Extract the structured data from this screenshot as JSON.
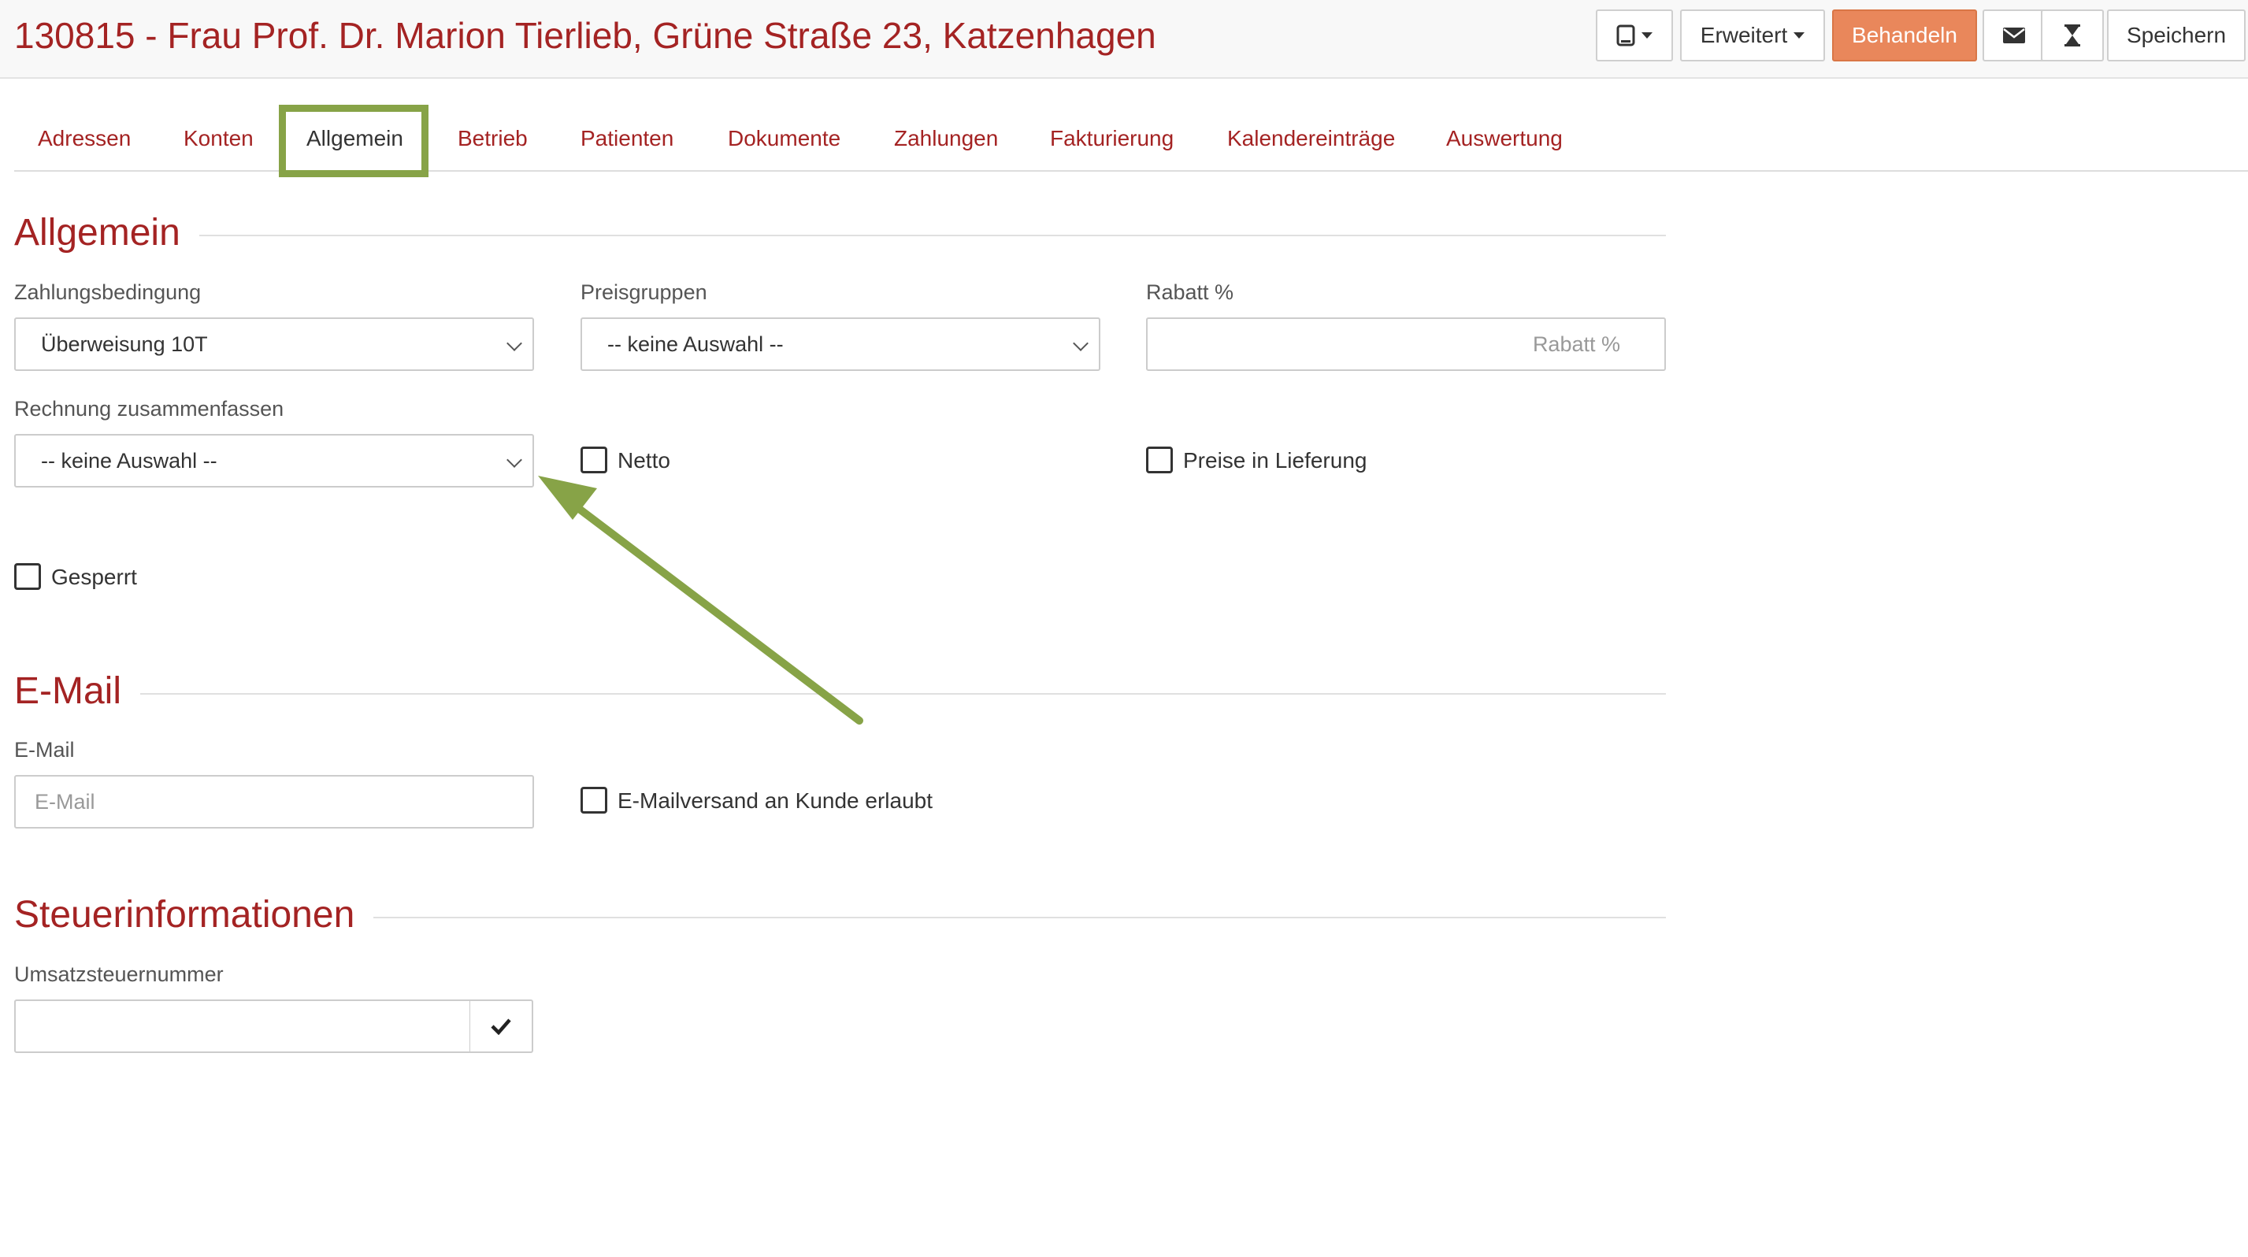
{
  "header": {
    "title": "130815 - Frau Prof. Dr. Marion Tierlieb, Grüne Straße 23, Katzenhagen",
    "buttons": {
      "device_icon": "tablet-icon",
      "erweitert": "Erweitert",
      "behandeln": "Behandeln",
      "mail_icon": "envelope-icon",
      "hourglass_icon": "hourglass-icon",
      "speichern": "Speichern"
    }
  },
  "tabs": [
    "Adressen",
    "Konten",
    "Allgemein",
    "Betrieb",
    "Patienten",
    "Dokumente",
    "Zahlungen",
    "Fakturierung",
    "Kalendereinträge",
    "Auswertung"
  ],
  "active_tab": "Allgemein",
  "sections": {
    "allgemein": {
      "title": "Allgemein",
      "zahlungsbedingung": {
        "label": "Zahlungsbedingung",
        "value": "Überweisung 10T"
      },
      "preisgruppen": {
        "label": "Preisgruppen",
        "value": "-- keine Auswahl --"
      },
      "rabatt": {
        "label": "Rabatt %",
        "placeholder": "Rabatt %"
      },
      "rechnung": {
        "label": "Rechnung zusammenfassen",
        "value": "-- keine Auswahl --"
      },
      "netto": {
        "label": "Netto",
        "checked": false
      },
      "preise_lieferung": {
        "label": "Preise in Lieferung",
        "checked": false
      },
      "gesperrt": {
        "label": "Gesperrt",
        "checked": false
      }
    },
    "email": {
      "title": "E-Mail",
      "email_field": {
        "label": "E-Mail",
        "placeholder": "E-Mail"
      },
      "versand": {
        "label": "E-Mailversand an Kunde erlaubt",
        "checked": false
      }
    },
    "steuer": {
      "title": "Steuerinformationen",
      "ust": {
        "label": "Umsatzsteuernummer",
        "value": ""
      },
      "check_icon": "checkmark-icon"
    }
  },
  "colors": {
    "brand_red": "#a42323",
    "accent_orange": "#e9875b",
    "annotation_green": "#87a347"
  }
}
